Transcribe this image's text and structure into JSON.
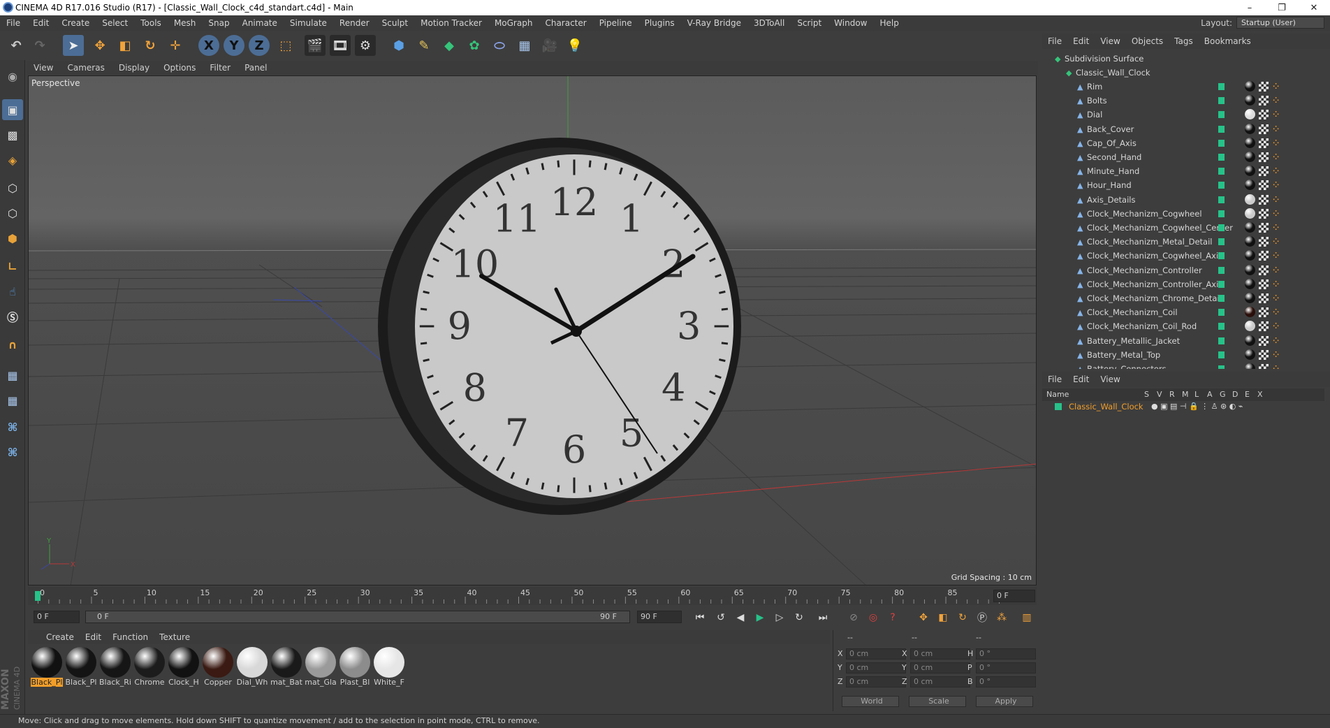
{
  "window": {
    "title": "CINEMA 4D R17.016 Studio (R17) - [Classic_Wall_Clock_c4d_standart.c4d] - Main",
    "controls": [
      "–",
      "❐",
      "✕"
    ]
  },
  "menu": [
    "File",
    "Edit",
    "Create",
    "Select",
    "Tools",
    "Mesh",
    "Snap",
    "Animate",
    "Simulate",
    "Render",
    "Sculpt",
    "Motion Tracker",
    "MoGraph",
    "Character",
    "Pipeline",
    "Plugins",
    "V-Ray Bridge",
    "3DToAll",
    "Script",
    "Window",
    "Help"
  ],
  "layout": {
    "label": "Layout:",
    "value": "Startup (User)"
  },
  "toolbar": {
    "axis_x": "X",
    "axis_y": "Y",
    "axis_z": "Z"
  },
  "viewport": {
    "menu": [
      "View",
      "Cameras",
      "Display",
      "Options",
      "Filter",
      "Panel"
    ],
    "label": "Perspective",
    "grid_spacing": "Grid Spacing : 10 cm",
    "axis_y": "Y",
    "axis_x": "X",
    "clock_numbers": [
      "12",
      "1",
      "2",
      "3",
      "4",
      "5",
      "6",
      "7",
      "8",
      "9",
      "10",
      "11"
    ]
  },
  "timeline": {
    "ticks": [
      "0",
      "5",
      "10",
      "15",
      "20",
      "25",
      "30",
      "35",
      "40",
      "45",
      "50",
      "55",
      "60",
      "65",
      "70",
      "75",
      "80",
      "85",
      "90"
    ],
    "current_frame": "0 F",
    "start_field": "0 F",
    "range_start": "0 F",
    "range_end": "90 F",
    "end_field": "90 F"
  },
  "materials": {
    "menu": [
      "Create",
      "Edit",
      "Function",
      "Texture"
    ],
    "items": [
      {
        "label": "Black_Pl",
        "color": "#111111",
        "active": true
      },
      {
        "label": "Black_Pl",
        "color": "#141414",
        "active": false
      },
      {
        "label": "Black_Ri",
        "color": "#161616",
        "active": false
      },
      {
        "label": "Chrome",
        "color": "#1c1c1c",
        "active": false
      },
      {
        "label": "Clock_H",
        "color": "#121212",
        "active": false
      },
      {
        "label": "Copper",
        "color": "#3a1a12",
        "active": false
      },
      {
        "label": "Dial_Wh",
        "color": "#d8d8d8",
        "active": false
      },
      {
        "label": "mat_Bat",
        "color": "#1a1a1a",
        "active": false
      },
      {
        "label": "mat_Gla",
        "color": "#9a9a9a",
        "active": false
      },
      {
        "label": "Plast_Bl",
        "color": "#8c8c8c",
        "active": false
      },
      {
        "label": "White_F",
        "color": "#e6e6e6",
        "active": false
      }
    ],
    "brand_top": "MAXON",
    "brand_bottom": "CINEMA 4D"
  },
  "coordinates": {
    "header": [
      "--",
      "--",
      "--"
    ],
    "rows": [
      {
        "a": "X",
        "av": "0 cm",
        "b": "X",
        "bv": "0 cm",
        "c": "H",
        "cv": "0 °"
      },
      {
        "a": "Y",
        "av": "0 cm",
        "b": "Y",
        "bv": "0 cm",
        "c": "P",
        "cv": "0 °"
      },
      {
        "a": "Z",
        "av": "0 cm",
        "b": "Z",
        "bv": "0 cm",
        "c": "B",
        "cv": "0 °"
      }
    ],
    "space": "World",
    "mode": "Scale",
    "apply": "Apply"
  },
  "objects": {
    "menu": [
      "File",
      "Edit",
      "View",
      "Objects",
      "Tags",
      "Bookmarks"
    ],
    "root": "Subdivision Surface",
    "group": "Classic_Wall_Clock",
    "items": [
      {
        "name": "Rim",
        "tag": "#111111"
      },
      {
        "name": "Bolts",
        "tag": "#111111"
      },
      {
        "name": "Dial",
        "tag": "#dddddd"
      },
      {
        "name": "Back_Cover",
        "tag": "#111111"
      },
      {
        "name": "Cap_Of_Axis",
        "tag": "#111111"
      },
      {
        "name": "Second_Hand",
        "tag": "#111111"
      },
      {
        "name": "Minute_Hand",
        "tag": "#111111"
      },
      {
        "name": "Hour_Hand",
        "tag": "#111111"
      },
      {
        "name": "Axis_Details",
        "tag": "#cccccc"
      },
      {
        "name": "Clock_Mechanizm_Cogwheel",
        "tag": "#cccccc"
      },
      {
        "name": "Clock_Mechanizm_Cogwheel_Center",
        "tag": "#111111"
      },
      {
        "name": "Clock_Mechanizm_Metal_Detail",
        "tag": "#111111"
      },
      {
        "name": "Clock_Mechanizm_Cogwheel_Axis",
        "tag": "#111111"
      },
      {
        "name": "Clock_Mechanizm_Controller",
        "tag": "#111111"
      },
      {
        "name": "Clock_Mechanizm_Controller_Axis",
        "tag": "#111111"
      },
      {
        "name": "Clock_Mechanizm_Chrome_Detail",
        "tag": "#111111"
      },
      {
        "name": "Clock_Mechanizm_Coil",
        "tag": "#2a0f0a"
      },
      {
        "name": "Clock_Mechanizm_Coil_Rod",
        "tag": "#cccccc"
      },
      {
        "name": "Battery_Metallic_Jacket",
        "tag": "#111111"
      },
      {
        "name": "Battery_Metal_Top",
        "tag": "#111111"
      },
      {
        "name": "Battery_Connectors",
        "tag": "#111111"
      }
    ]
  },
  "layers": {
    "menu": [
      "File",
      "Edit",
      "View"
    ],
    "columns": [
      "Name",
      "S",
      "V",
      "R",
      "M",
      "L",
      "A",
      "G",
      "D",
      "E",
      "X"
    ],
    "row": "Classic_Wall_Clock"
  },
  "status": "Move: Click and drag to move elements. Hold down SHIFT to quantize movement / add to the selection in point mode, CTRL to remove.",
  "colors": {
    "accent": "#f29e2a",
    "selected": "#4c6d95",
    "layer_green": "#27c28a"
  }
}
